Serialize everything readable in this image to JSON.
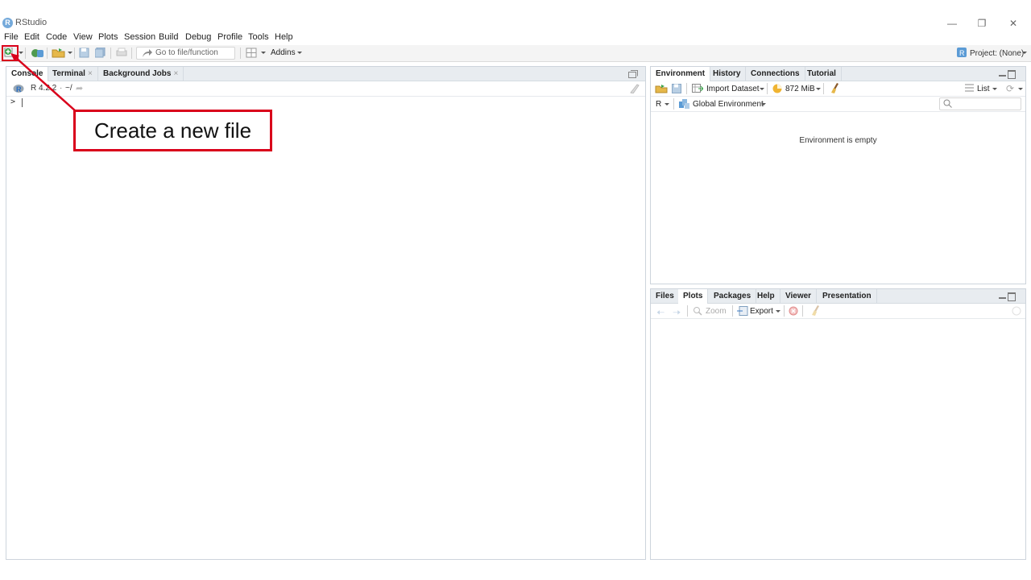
{
  "window": {
    "title": "RStudio",
    "logo_letter": "R"
  },
  "menu": [
    "File",
    "Edit",
    "Code",
    "View",
    "Plots",
    "Session",
    "Build",
    "Debug",
    "Profile",
    "Tools",
    "Help"
  ],
  "toolbar": {
    "goto_placeholder": "Go to file/function",
    "addins_label": "Addins",
    "project_label": "Project: (None)"
  },
  "console_pane": {
    "tabs": [
      {
        "label": "Console",
        "closable": false
      },
      {
        "label": "Terminal",
        "closable": true
      },
      {
        "label": "Background Jobs",
        "closable": true
      }
    ],
    "r_version": "R 4.2.2",
    "path": "~/",
    "prompt": ">"
  },
  "env_pane": {
    "tabs": [
      "Environment",
      "History",
      "Connections",
      "Tutorial"
    ],
    "import_label": "Import Dataset",
    "memory_label": "872 MiB",
    "view_label": "List",
    "lang_label": "R",
    "scope_label": "Global Environment",
    "empty_message": "Environment is empty"
  },
  "files_pane": {
    "tabs": [
      "Files",
      "Plots",
      "Packages",
      "Help",
      "Viewer",
      "Presentation"
    ],
    "zoom_label": "Zoom",
    "export_label": "Export"
  },
  "annotation": {
    "text": "Create a new file",
    "color": "#d9001b"
  },
  "colors": {
    "accent": "#75aadb",
    "pane_border": "#cdd4dc",
    "tab_bg": "#e8ecf0"
  }
}
